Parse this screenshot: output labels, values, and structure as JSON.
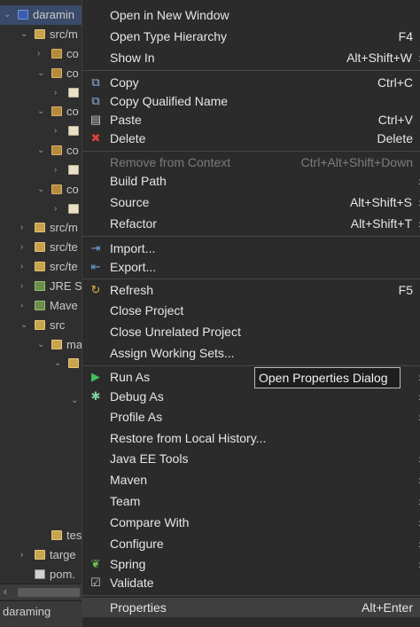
{
  "tree": {
    "rows": [
      {
        "label": "daramin",
        "kind": "proj",
        "indent": 0,
        "twisty": "⌄"
      },
      {
        "label": "src/m",
        "kind": "pkgroot",
        "indent": 1,
        "twisty": "⌄"
      },
      {
        "label": "co",
        "kind": "pkg",
        "indent": 2,
        "twisty": "›"
      },
      {
        "label": "co",
        "kind": "pkg",
        "indent": 2,
        "twisty": "⌄"
      },
      {
        "label": "",
        "kind": "file",
        "indent": 3,
        "twisty": "›"
      },
      {
        "label": "co",
        "kind": "pkg",
        "indent": 2,
        "twisty": "⌄"
      },
      {
        "label": "",
        "kind": "file",
        "indent": 3,
        "twisty": "›"
      },
      {
        "label": "co",
        "kind": "pkg",
        "indent": 2,
        "twisty": "⌄"
      },
      {
        "label": "",
        "kind": "file",
        "indent": 3,
        "twisty": "›"
      },
      {
        "label": "co",
        "kind": "pkg",
        "indent": 2,
        "twisty": "⌄"
      },
      {
        "label": "",
        "kind": "file",
        "indent": 3,
        "twisty": "›"
      },
      {
        "label": "src/m",
        "kind": "pkgroot",
        "indent": 1,
        "twisty": "›"
      },
      {
        "label": "src/te",
        "kind": "pkgroot",
        "indent": 1,
        "twisty": "›"
      },
      {
        "label": "src/te",
        "kind": "pkgroot",
        "indent": 1,
        "twisty": "›"
      },
      {
        "label": "JRE S",
        "kind": "lib",
        "indent": 1,
        "twisty": "›"
      },
      {
        "label": "Mave",
        "kind": "lib",
        "indent": 1,
        "twisty": "›"
      },
      {
        "label": "src",
        "kind": "folder",
        "indent": 1,
        "twisty": "⌄"
      },
      {
        "label": "ma",
        "kind": "folder",
        "indent": 2,
        "twisty": "⌄"
      },
      {
        "label": "",
        "kind": "folder",
        "indent": 3,
        "twisty": "⌄"
      },
      {
        "label": "",
        "kind": "none",
        "indent": 4,
        "twisty": "⌄"
      },
      {
        "label": "tes",
        "kind": "folder",
        "indent": 2,
        "twisty": ""
      },
      {
        "label": "targe",
        "kind": "folder",
        "indent": 1,
        "twisty": "›"
      },
      {
        "label": "pom.",
        "kind": "xml",
        "indent": 1,
        "twisty": ""
      }
    ],
    "status_label": "daraming"
  },
  "menu": {
    "items": [
      {
        "label": "Open in New Window",
        "shortcut": "",
        "icon": "",
        "submenu": false,
        "disabled": false
      },
      {
        "label": "Open Type Hierarchy",
        "shortcut": "F4",
        "icon": "",
        "submenu": false,
        "disabled": false
      },
      {
        "label": "Show In",
        "shortcut": "Alt+Shift+W",
        "icon": "",
        "submenu": true,
        "disabled": false
      },
      {
        "sep": true
      },
      {
        "label": "Copy",
        "shortcut": "Ctrl+C",
        "icon": "copy-icon",
        "submenu": false,
        "disabled": false
      },
      {
        "label": "Copy Qualified Name",
        "shortcut": "",
        "icon": "copy-qualified-icon",
        "submenu": false,
        "disabled": false
      },
      {
        "label": "Paste",
        "shortcut": "Ctrl+V",
        "icon": "paste-icon",
        "submenu": false,
        "disabled": false
      },
      {
        "label": "Delete",
        "shortcut": "Delete",
        "icon": "delete-icon",
        "submenu": false,
        "disabled": false
      },
      {
        "sep": true
      },
      {
        "label": "Remove from Context",
        "shortcut": "Ctrl+Alt+Shift+Down",
        "icon": "",
        "submenu": false,
        "disabled": true
      },
      {
        "label": "Build Path",
        "shortcut": "",
        "icon": "",
        "submenu": true,
        "disabled": false
      },
      {
        "label": "Source",
        "shortcut": "Alt+Shift+S",
        "icon": "",
        "submenu": true,
        "disabled": false
      },
      {
        "label": "Refactor",
        "shortcut": "Alt+Shift+T",
        "icon": "",
        "submenu": true,
        "disabled": false
      },
      {
        "sep": true
      },
      {
        "label": "Import...",
        "shortcut": "",
        "icon": "import-icon",
        "submenu": false,
        "disabled": false
      },
      {
        "label": "Export...",
        "shortcut": "",
        "icon": "export-icon",
        "submenu": false,
        "disabled": false
      },
      {
        "sep": true
      },
      {
        "label": "Refresh",
        "shortcut": "F5",
        "icon": "refresh-icon",
        "submenu": false,
        "disabled": false
      },
      {
        "label": "Close Project",
        "shortcut": "",
        "icon": "",
        "submenu": false,
        "disabled": false
      },
      {
        "label": "Close Unrelated Project",
        "shortcut": "",
        "icon": "",
        "submenu": false,
        "disabled": false
      },
      {
        "label": "Assign Working Sets...",
        "shortcut": "",
        "icon": "",
        "submenu": false,
        "disabled": false
      },
      {
        "sep": true
      },
      {
        "label": "Run As",
        "shortcut": "",
        "icon": "run-icon",
        "submenu": true,
        "disabled": false
      },
      {
        "label": "Debug As",
        "shortcut": "",
        "icon": "debug-icon",
        "submenu": true,
        "disabled": false
      },
      {
        "label": "Profile As",
        "shortcut": "",
        "icon": "",
        "submenu": true,
        "disabled": false
      },
      {
        "label": "Restore from Local History...",
        "shortcut": "",
        "icon": "",
        "submenu": false,
        "disabled": false
      },
      {
        "label": "Java EE Tools",
        "shortcut": "",
        "icon": "",
        "submenu": true,
        "disabled": false
      },
      {
        "label": "Maven",
        "shortcut": "",
        "icon": "",
        "submenu": true,
        "disabled": false
      },
      {
        "label": "Team",
        "shortcut": "",
        "icon": "",
        "submenu": true,
        "disabled": false
      },
      {
        "label": "Compare With",
        "shortcut": "",
        "icon": "",
        "submenu": true,
        "disabled": false
      },
      {
        "label": "Configure",
        "shortcut": "",
        "icon": "",
        "submenu": true,
        "disabled": false
      },
      {
        "label": "Spring",
        "shortcut": "",
        "icon": "spring-icon",
        "submenu": true,
        "disabled": false
      },
      {
        "label": "Validate",
        "shortcut": "",
        "icon": "validate-icon",
        "submenu": false,
        "disabled": false
      },
      {
        "sep": true
      },
      {
        "label": "Properties",
        "shortcut": "Alt+Enter",
        "icon": "",
        "submenu": false,
        "disabled": false,
        "highlighted": true
      }
    ]
  },
  "tooltip": {
    "text": "Open Properties Dialog"
  },
  "colors": {
    "menu_bg": "#2b2b2b",
    "tree_bg": "#2f2f2f",
    "text": "#e6e6e6",
    "disabled_text": "#7c7c7c",
    "highlight": "#3f3f3f"
  }
}
